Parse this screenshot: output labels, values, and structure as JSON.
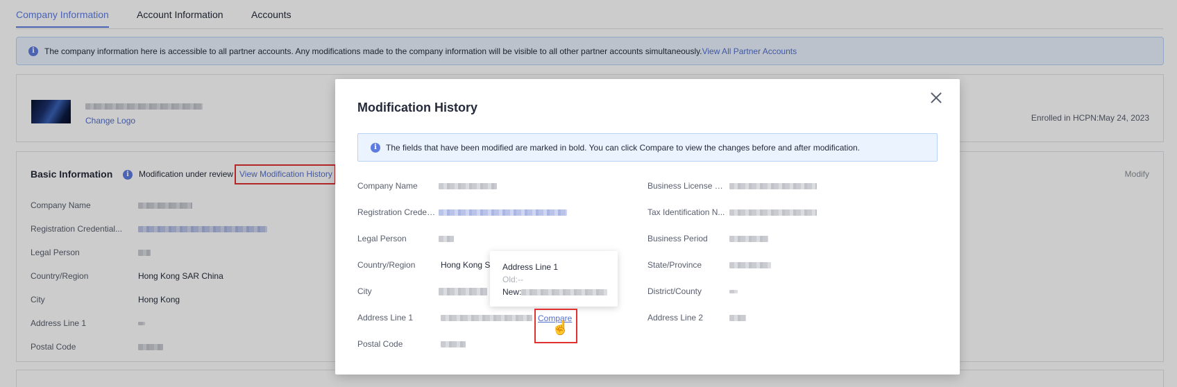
{
  "tabs": [
    "Company Information",
    "Account Information",
    "Accounts"
  ],
  "notice": {
    "text": "The company information here is accessible to all partner accounts. Any modifications made to the company information will be visible to all other partner accounts simultaneously.",
    "link": "View All Partner Accounts"
  },
  "logo_card": {
    "change_logo": "Change Logo",
    "enrolled": "Enrolled in HCPN:May 24, 2023"
  },
  "basic": {
    "title": "Basic Information",
    "review": "Modification under review",
    "view_history": "View Modification History",
    "modify": "Modify",
    "fields": [
      {
        "label": "Company Name",
        "value": ""
      },
      {
        "label": "Registration Credential...",
        "value": ""
      },
      {
        "label": "Legal Person",
        "value": ""
      },
      {
        "label": "Country/Region",
        "value": "Hong Kong SAR China"
      },
      {
        "label": "City",
        "value": "Hong Kong"
      },
      {
        "label": "Address Line 1",
        "value": ""
      },
      {
        "label": "Postal Code",
        "value": ""
      }
    ]
  },
  "modal": {
    "title": "Modification History",
    "notice": "The fields that have been modified are marked in bold. You can click Compare to view the changes before and after modification.",
    "left_fields": [
      {
        "label": "Company Name"
      },
      {
        "label": "Registration Creden..."
      },
      {
        "label": "Legal Person"
      },
      {
        "label": "Country/Region",
        "value": "Hong Kong S"
      },
      {
        "label": "City"
      },
      {
        "label": "Address Line 1"
      },
      {
        "label": "Postal Code"
      }
    ],
    "right_fields": [
      {
        "label": "Business License R..."
      },
      {
        "label": "Tax Identification N..."
      },
      {
        "label": "Business Period"
      },
      {
        "label": "State/Province"
      },
      {
        "label": "District/County"
      },
      {
        "label": "Address Line 2"
      }
    ],
    "compare": "Compare",
    "popover": {
      "title": "Address Line 1",
      "old": "Old:--",
      "new_label": "New:"
    }
  },
  "colors": {
    "accent": "#5e7ce0",
    "link": "#526ecc",
    "highlight_border": "#e03030",
    "notice_bg": "#ebf3fe"
  }
}
